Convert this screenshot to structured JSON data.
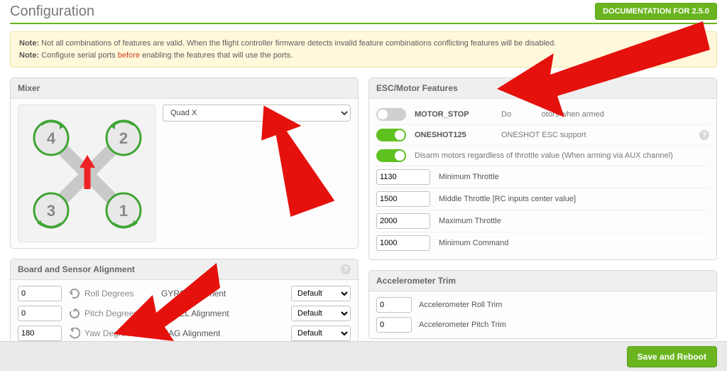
{
  "header": {
    "title": "Configuration",
    "doc_button": "DOCUMENTATION FOR 2.5.0"
  },
  "note": {
    "prefix": "Note:",
    "line1": "Not all combinations of features are valid. When the flight controller firmware detects invalid feature combinations conflicting features will be disabled.",
    "line2a": "Configure serial ports",
    "red_word": "before",
    "line2b": "enabling the features that will use the ports."
  },
  "mixer": {
    "title": "Mixer",
    "selected": "Quad X",
    "motors": [
      "4",
      "2",
      "3",
      "1"
    ]
  },
  "board_align": {
    "title": "Board and Sensor Alignment",
    "roll_value": "0",
    "roll_label": "Roll Degrees",
    "pitch_value": "0",
    "pitch_label": "Pitch Degrees",
    "yaw_value": "180",
    "yaw_label": "Yaw Degrees",
    "gyro_label": "GYRO Alignment",
    "accel_label": "ACCEL Alignment",
    "mag_label": "MAG Alignment",
    "default_opt": "Default"
  },
  "esc": {
    "title": "ESC/Motor Features",
    "motor_stop": {
      "name": "MOTOR_STOP",
      "desc_pre": "Do",
      "desc_post": "otors when armed"
    },
    "oneshot": {
      "name": "ONESHOT125",
      "desc": "ONESHOT ESC support"
    },
    "disarm_desc": "Disarm motors regardless of throttle value (When arming via AUX channel)",
    "min_throttle": {
      "value": "1130",
      "label": "Minimum Throttle"
    },
    "mid_throttle": {
      "value": "1500",
      "label": "Middle Throttle [RC inputs center value]"
    },
    "max_throttle": {
      "value": "2000",
      "label": "Maximum Throttle"
    },
    "min_command": {
      "value": "1000",
      "label": "Minimum Command"
    }
  },
  "accel": {
    "title": "Accelerometer Trim",
    "roll": {
      "value": "0",
      "label": "Accelerometer Roll Trim"
    },
    "pitch": {
      "value": "0",
      "label": "Accelerometer Pitch Trim"
    }
  },
  "footer": {
    "save": "Save and Reboot"
  }
}
